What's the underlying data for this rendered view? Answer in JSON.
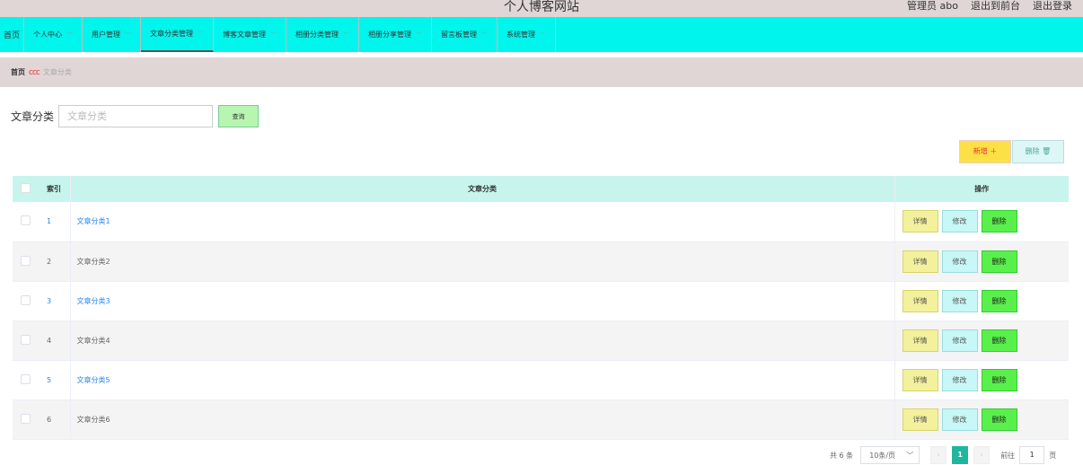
{
  "site_title": "个人博客网站",
  "top_links": [
    "管理员 abo",
    "退出到前台",
    "退出登录"
  ],
  "nav": [
    {
      "label": "首页",
      "chev": false
    },
    {
      "label": "个人中心",
      "chev": true
    },
    {
      "label": "用户管理",
      "chev": true
    },
    {
      "label": "文章分类管理",
      "chev": true,
      "active": true
    },
    {
      "label": "博客文章管理",
      "chev": true
    },
    {
      "label": "相册分类管理",
      "chev": true
    },
    {
      "label": "相册分享管理",
      "chev": true
    },
    {
      "label": "留言板管理",
      "chev": true
    },
    {
      "label": "系统管理",
      "chev": true
    }
  ],
  "breadcrumb": {
    "home": "首页",
    "sep": "ccc",
    "current": "文章分类"
  },
  "search": {
    "label": "文章分类",
    "placeholder": "文章分类",
    "button": "查询"
  },
  "actions": {
    "add": "新增 ＋",
    "delete": "删除 🗑"
  },
  "table": {
    "headers": [
      "索引",
      "文章分类",
      "操作"
    ],
    "rows": [
      {
        "index": "1",
        "name": "文章分类1"
      },
      {
        "index": "2",
        "name": "文章分类2"
      },
      {
        "index": "3",
        "name": "文章分类3"
      },
      {
        "index": "4",
        "name": "文章分类4"
      },
      {
        "index": "5",
        "name": "文章分类5"
      },
      {
        "index": "6",
        "name": "文章分类6"
      }
    ],
    "row_actions": {
      "detail": "详情",
      "edit": "修改",
      "delete": "删除"
    }
  },
  "pagination": {
    "total": "共 6 条",
    "page_size": "10条/页",
    "current_page": "1",
    "goto_label": "前往",
    "goto_value": "1",
    "page_unit": "页"
  }
}
